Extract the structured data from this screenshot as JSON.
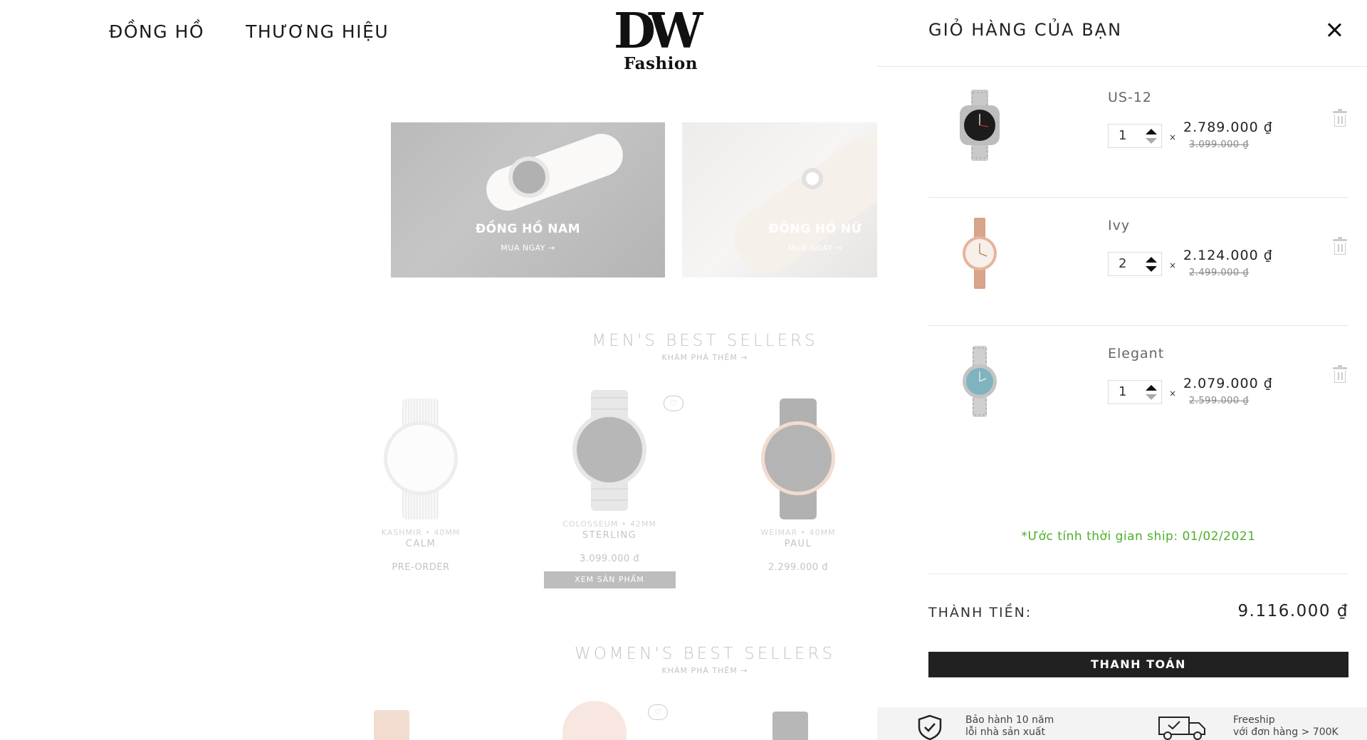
{
  "nav": {
    "item1": "ĐỒNG HỒ",
    "item2": "THƯƠNG HIỆU"
  },
  "logo": {
    "mark": "DW",
    "text": "Fashion"
  },
  "banners": {
    "men": {
      "title": "ĐỒNG HỒ NAM",
      "cta": "MUA NGAY →"
    },
    "women": {
      "title": "ĐỒNG HỒ NỮ",
      "cta": "MUA NGAY →"
    }
  },
  "mens_section": {
    "title": "MEN'S BEST SELLERS",
    "more": "KHÁM PHÁ THÊM →",
    "products": [
      {
        "meta": "KASHMIR • 40MM",
        "name": "CALM",
        "price": "PRE-ORDER"
      },
      {
        "meta": "COLOSSEUM • 42MM",
        "name": "STERLING",
        "price": "3.099.000 đ",
        "button": "XEM SẢN PHẨM"
      },
      {
        "meta": "WEIMAR • 40MM",
        "name": "PAUL",
        "price": "2.299.000 đ"
      }
    ]
  },
  "womens_section": {
    "title": "WOMEN'S BEST SELLERS",
    "more": "KHÁM PHÁ THÊM →"
  },
  "cart": {
    "title": "GIỎ HÀNG CỦA BẠN",
    "items": [
      {
        "name": "US-12",
        "qty": "1",
        "price": "2.789.000 ₫",
        "old_price": "3.099.000 ₫"
      },
      {
        "name": "Ivy",
        "qty": "2",
        "price": "2.124.000 ₫",
        "old_price": "2.499.000 ₫"
      },
      {
        "name": "Elegant",
        "qty": "1",
        "price": "2.079.000 ₫",
        "old_price": "2.599.000 ₫"
      }
    ],
    "times": "×",
    "ship_estimate": "*Ước tính thời gian ship: 01/02/2021",
    "total_label": "THÀNH TIỀN:",
    "total_value": "9.116.000 ₫",
    "checkout": "THANH TOÁN",
    "perks": [
      {
        "line1": "Bảo hành 10 năm",
        "line2": "lỗi nhà sản xuất"
      },
      {
        "line1": "Freeship",
        "line2": "với đơn hàng > 700K"
      }
    ]
  },
  "colors": {
    "accent_green": "#4caf2a",
    "checkout_bg": "#212121"
  }
}
